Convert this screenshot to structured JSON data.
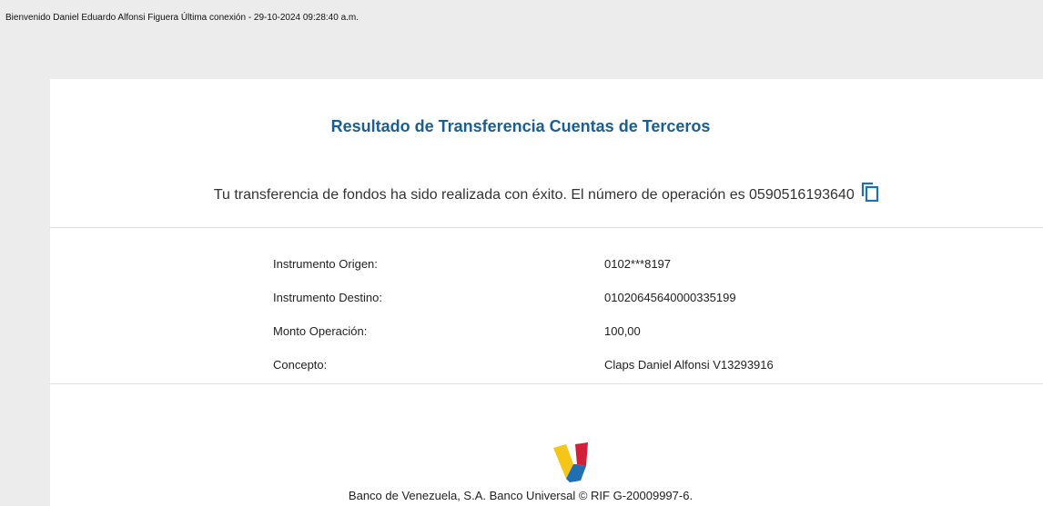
{
  "header": {
    "welcome_text": "Bienvenido Daniel Eduardo Alfonsi Figuera Última conexión - 29-10-2024 09:28:40 a.m."
  },
  "result": {
    "title": "Resultado de Transferencia Cuentas de Terceros",
    "message": "Tu transferencia de fondos ha sido realizada con éxito. El número de operación es 0590516193640",
    "copy_icon": "copy-icon"
  },
  "details": [
    {
      "label": "Instrumento Origen:",
      "value": "0102***8197"
    },
    {
      "label": "Instrumento Destino:",
      "value": "01020645640000335199"
    },
    {
      "label": "Monto Operación:",
      "value": "100,00"
    },
    {
      "label": "Concepto:",
      "value": "Claps Daniel Alfonsi V13293916"
    }
  ],
  "footer": {
    "logo_icon": "banco-de-venezuela-logo",
    "text": "Banco de Venezuela, S.A. Banco Universal © RIF G-20009997-6."
  },
  "colors": {
    "title": "#1d5e91",
    "logo_yellow": "#f5c518",
    "logo_red": "#d0203a",
    "logo_blue": "#1f6fb2"
  }
}
